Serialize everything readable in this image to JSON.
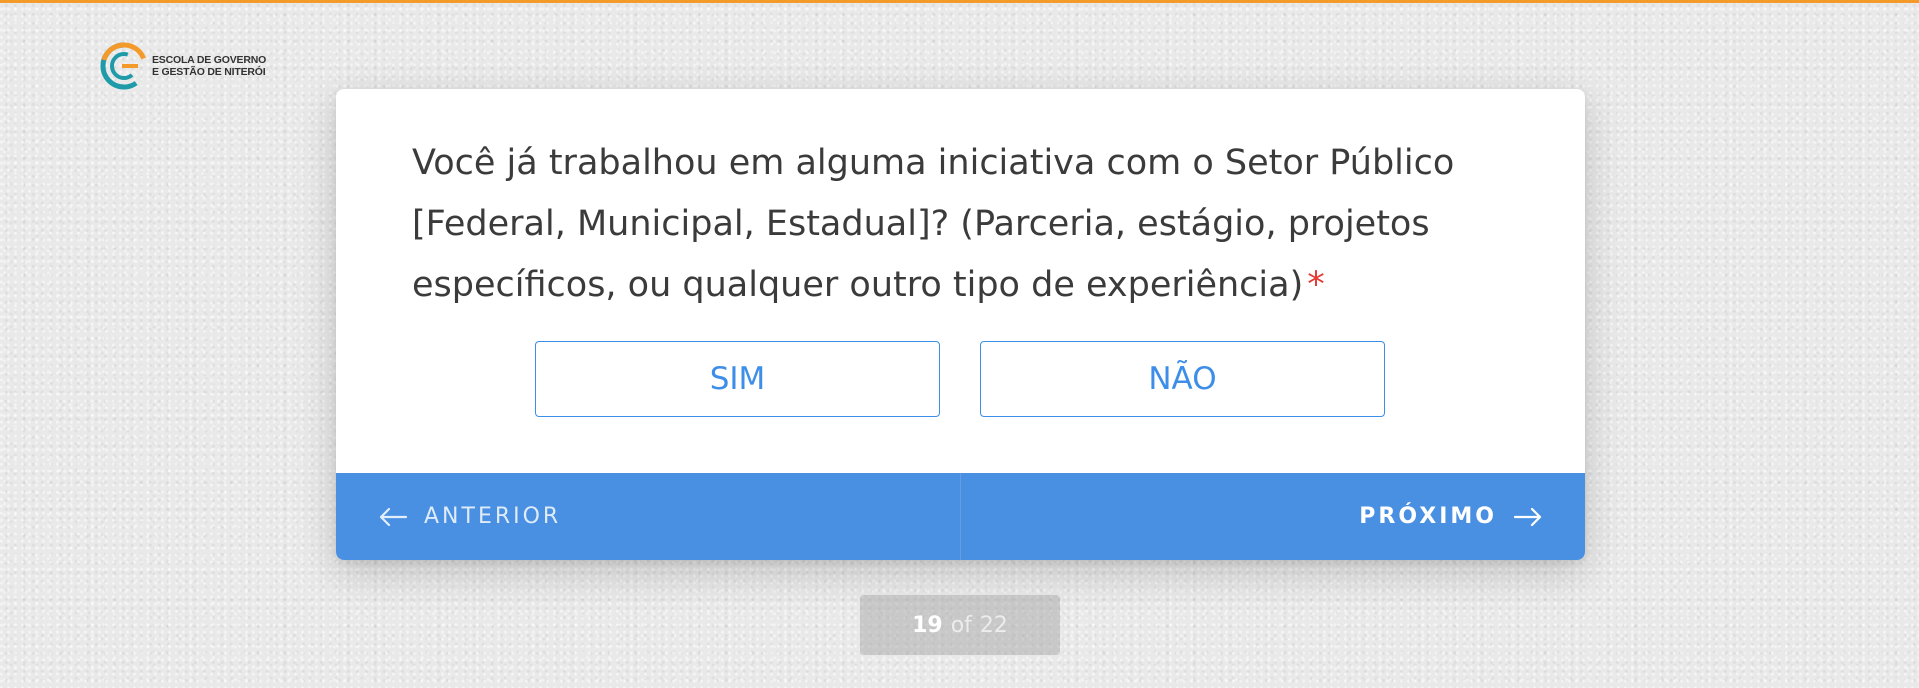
{
  "brand": {
    "logo_line1": "ESCOLA DE GOVERNO",
    "logo_line2": "E GESTÃO DE NITERÓI",
    "accent_orange": "#f39a2b",
    "accent_teal": "#1f9aa8"
  },
  "question": {
    "text": "Você já trabalhou em alguma iniciativa com o Setor Público [Federal, Municipal, Estadual]? (Parceria, estágio, projetos específicos, ou qualquer outro tipo de experiência)",
    "required_marker": "*"
  },
  "answers": [
    {
      "label": "SIM"
    },
    {
      "label": "NÃO"
    }
  ],
  "navigation": {
    "prev_label": "ANTERIOR",
    "next_label": "PRÓXIMO",
    "bar_color": "#4a90e2"
  },
  "progress": {
    "current": "19",
    "of_label": "of",
    "total": "22"
  }
}
